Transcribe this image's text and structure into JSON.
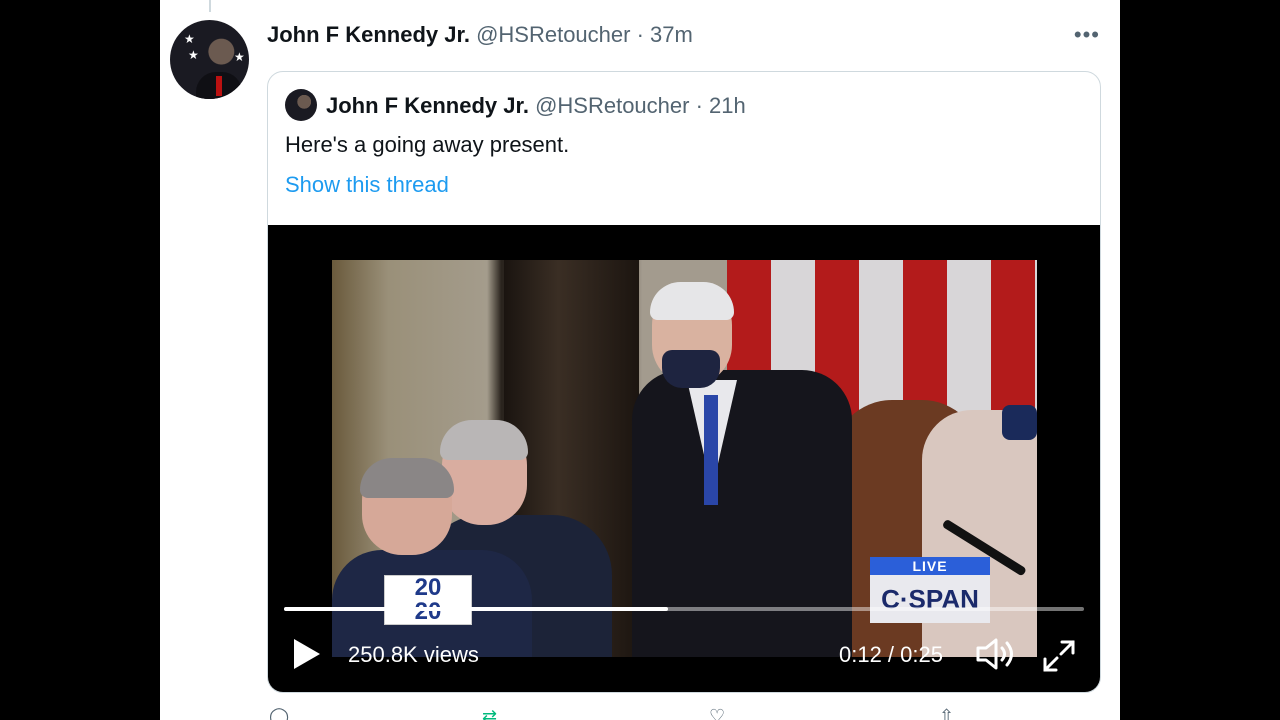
{
  "tweet": {
    "author_name": "John F Kennedy Jr.",
    "handle": "@HSRetoucher",
    "separator": "·",
    "time": "37m",
    "more_icon": "more-icon",
    "more_glyph": "•••"
  },
  "quoted": {
    "author_name": "John F Kennedy Jr.",
    "handle": "@HSRetoucher",
    "separator": "·",
    "time": "21h",
    "text": "Here's a going away present.",
    "show_thread": "Show this thread"
  },
  "video": {
    "logo_2020_line1": "20",
    "logo_2020_line2": "20",
    "live_label": "LIVE",
    "network_label": "C·SPAN",
    "views": "250.8K views",
    "time_display": "0:12 / 0:25",
    "progress_fraction": 0.48,
    "play_icon": "play-icon",
    "volume_icon": "volume-icon",
    "fullscreen_icon": "fullscreen-icon"
  },
  "colors": {
    "link": "#1d9bf0",
    "muted": "#536471",
    "text": "#0f1419"
  }
}
